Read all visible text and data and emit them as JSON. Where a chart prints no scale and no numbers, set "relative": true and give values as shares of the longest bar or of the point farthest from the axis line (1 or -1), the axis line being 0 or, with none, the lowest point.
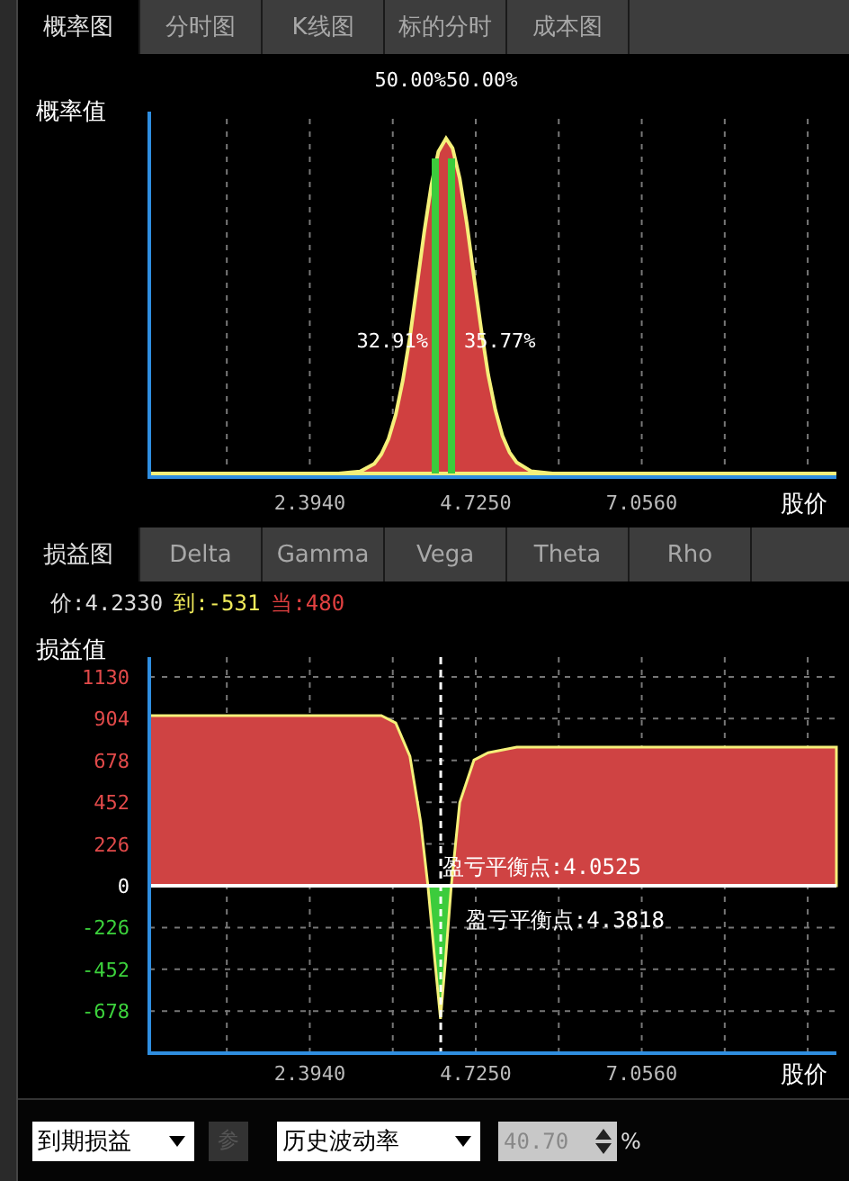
{
  "chart_tabs": [
    {
      "label": "概率图",
      "selected": true
    },
    {
      "label": "分时图",
      "selected": false
    },
    {
      "label": "K线图",
      "selected": false
    },
    {
      "label": "标的分时",
      "selected": false
    },
    {
      "label": "成本图",
      "selected": false
    }
  ],
  "probability": {
    "top_label": "50.00%50.00%",
    "band_labels": [
      "32.91%",
      "35.77%"
    ],
    "chart_data": {
      "type": "area",
      "relative": true,
      "grid": true,
      "ylabel": "概率值",
      "xlabel": "股价",
      "xlim": [
        0.14,
        9.79
      ],
      "x": [
        0.14,
        2.8,
        3.1,
        3.3,
        3.4,
        3.5,
        3.6,
        3.7,
        3.8,
        3.9,
        4.0,
        4.1,
        4.2,
        4.308,
        4.4,
        4.5,
        4.6,
        4.7,
        4.8,
        4.9,
        5.0,
        5.1,
        5.2,
        5.3,
        5.5,
        5.8,
        9.79
      ],
      "series": [
        {
          "values": [
            0,
            0,
            0.006,
            0.029,
            0.057,
            0.103,
            0.175,
            0.276,
            0.407,
            0.56,
            0.719,
            0.86,
            0.96,
            1,
            0.971,
            0.88,
            0.743,
            0.586,
            0.431,
            0.295,
            0.189,
            0.113,
            0.063,
            0.033,
            0.007,
            0,
            0
          ]
        }
      ],
      "xticks": [
        {
          "value": 2.394,
          "label": "2.3940"
        },
        {
          "value": 4.725,
          "label": "4.7250"
        },
        {
          "value": 7.056,
          "label": "7.0560"
        }
      ],
      "ref_lines": [
        {
          "axis": "x",
          "value": 4.157
        },
        {
          "axis": "x",
          "value": 4.384
        }
      ]
    }
  },
  "greek_tabs": [
    {
      "label": "损益图",
      "selected": true
    },
    {
      "label": "Delta",
      "selected": false
    },
    {
      "label": "Gamma",
      "selected": false
    },
    {
      "label": "Vega",
      "selected": false
    },
    {
      "label": "Theta",
      "selected": false
    },
    {
      "label": "Rho",
      "selected": false
    }
  ],
  "quote": [
    {
      "kind": "price",
      "text": "价:4.2330"
    },
    {
      "kind": "expiry",
      "text": "到:-531"
    },
    {
      "kind": "current",
      "text": "当:480"
    }
  ],
  "payoff": {
    "chart_data": {
      "type": "area",
      "ylabel": "损益值",
      "xlabel": "股价",
      "xlim": [
        0.14,
        9.79
      ],
      "ylim": [
        -906,
        1237
      ],
      "grid": true,
      "x": [
        0.14,
        3.4,
        3.6,
        3.8,
        3.95,
        4.0525,
        4.15,
        4.23,
        4.3,
        4.3818,
        4.5,
        4.7,
        4.9,
        5.3,
        9.79
      ],
      "series": [
        {
          "values": [
            920,
            920,
            880,
            700,
            350,
            0,
            -400,
            -720,
            -400,
            0,
            450,
            680,
            720,
            750,
            750
          ]
        }
      ],
      "xticks": [
        {
          "value": 2.394,
          "label": "2.3940"
        },
        {
          "value": 4.725,
          "label": "4.7250"
        },
        {
          "value": 7.056,
          "label": "7.0560"
        }
      ],
      "yticks": [
        {
          "value": 1130,
          "label": "1130"
        },
        {
          "value": 904,
          "label": "904"
        },
        {
          "value": 678,
          "label": "678"
        },
        {
          "value": 452,
          "label": "452"
        },
        {
          "value": 226,
          "label": "226"
        },
        {
          "value": 0,
          "label": "0"
        },
        {
          "value": -226,
          "label": "-226"
        },
        {
          "value": -452,
          "label": "-452"
        },
        {
          "value": -678,
          "label": "-678"
        }
      ],
      "ref_lines": [
        {
          "axis": "x",
          "value": 4.233
        },
        {
          "axis": "y",
          "value": 0
        }
      ],
      "annotations": [
        {
          "text": "盈亏平衡点:4.0525",
          "x": 4.0525,
          "y": 65
        },
        {
          "text": "盈亏平衡点:4.3818",
          "x": 4.3818,
          "y": -224
        }
      ]
    }
  },
  "controls": {
    "mode_select": {
      "value": "到期损益"
    },
    "param_button": {
      "label": "参",
      "disabled": true
    },
    "vol_select": {
      "value": "历史波动率"
    },
    "vol_input": {
      "value": "40.70",
      "disabled": true
    },
    "unit": "%"
  }
}
